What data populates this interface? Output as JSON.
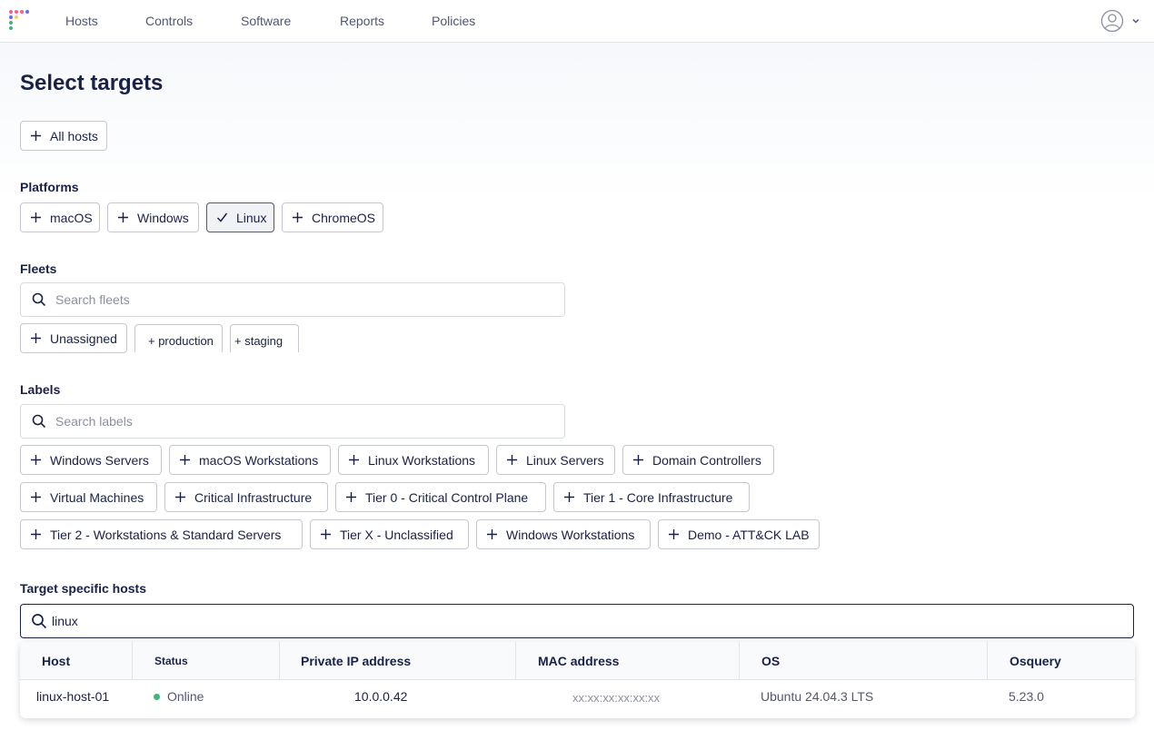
{
  "nav": {
    "items": [
      "Hosts",
      "Controls",
      "Software",
      "Reports",
      "Policies"
    ],
    "logo_colors": [
      "#ff5c83",
      "#6a67fe",
      "#3db67b",
      "#ffca64"
    ]
  },
  "page": {
    "title": "Select targets"
  },
  "all_hosts": {
    "label": "All hosts"
  },
  "platforms": {
    "heading": "Platforms",
    "items": [
      {
        "label": "macOS",
        "selected": false
      },
      {
        "label": "Windows",
        "selected": false
      },
      {
        "label": "Linux",
        "selected": true
      },
      {
        "label": "ChromeOS",
        "selected": false
      }
    ]
  },
  "fleets": {
    "heading": "Fleets",
    "placeholder": "Search fleets",
    "items": [
      "Unassigned",
      "+ production",
      "+ staging"
    ]
  },
  "labels": {
    "heading": "Labels",
    "placeholder": "Search labels",
    "rows": [
      [
        "Windows Servers",
        "macOS Workstations",
        "Linux Workstations",
        "Linux Servers",
        "Domain Controllers"
      ],
      [
        "Virtual Machines",
        "Critical Infrastructure",
        "Tier 0 - Critical Control Plane",
        "Tier 1 - Core Infrastructure"
      ],
      [
        "Tier 2 - Workstations & Standard Servers",
        "Tier X - Unclassified",
        "Windows Workstations",
        "Demo - ATT&CK LAB"
      ]
    ]
  },
  "target_hosts": {
    "heading": "Target specific hosts",
    "search_value": "linux",
    "columns": [
      "Host",
      "Status",
      "Private IP address",
      "MAC address",
      "OS",
      "Osquery"
    ],
    "rows": [
      {
        "host": "linux-host-01",
        "status": "Online",
        "private_ip": "10.0.0.42",
        "mac": "xx:xx:xx:xx:xx:xx",
        "os": "Ubuntu 24.04.3 LTS",
        "osquery": "5.23.0"
      }
    ],
    "status_color": "#3db67b"
  }
}
